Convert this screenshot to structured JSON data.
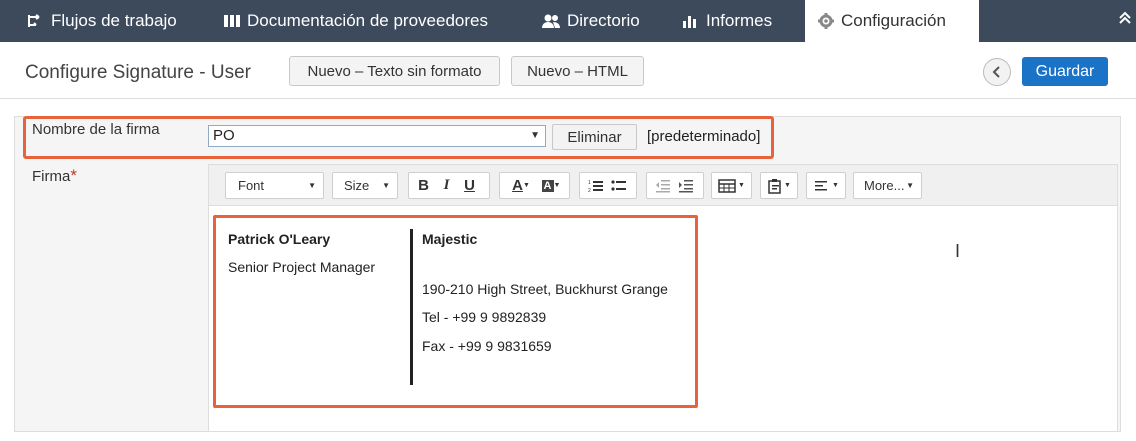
{
  "nav": {
    "items": [
      {
        "label": "Flujos de trabajo",
        "icon": "workflow-icon"
      },
      {
        "label": "Documentación de proveedores",
        "icon": "library-icon"
      },
      {
        "label": "Directorio",
        "icon": "people-icon"
      },
      {
        "label": "Informes",
        "icon": "bar-chart-icon"
      },
      {
        "label": "Configuración",
        "icon": "gear-icon"
      }
    ],
    "active": "Configuración"
  },
  "header": {
    "title": "Configure Signature - User",
    "new_plain": "Nuevo – Texto sin formato",
    "new_html": "Nuevo – HTML",
    "save": "Guardar"
  },
  "form": {
    "name_label": "Nombre de la firma",
    "name_value": "PO",
    "delete": "Eliminar",
    "default_tag": "[predeterminado]",
    "sig_label": "Firma",
    "required_mark": "*"
  },
  "toolbar": {
    "font": "Font",
    "size": "Size",
    "more": "More..."
  },
  "signature": {
    "name": "Patrick O'Leary",
    "role": "Senior Project Manager",
    "company": "Majestic",
    "address": "190-210 High Street, Buckhurst Grange",
    "tel": "Tel - +99 9 9892839",
    "fax": "Fax - +99 9 9831659"
  },
  "colors": {
    "nav_bg": "#3d4a5b",
    "primary": "#1a73c7",
    "highlight": "#e8623b"
  }
}
